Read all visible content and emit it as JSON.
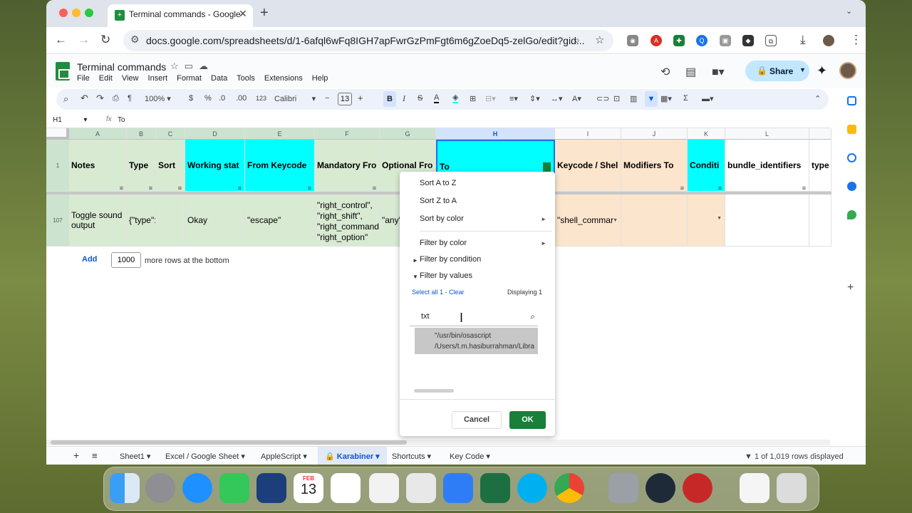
{
  "browser": {
    "tab_title": "Terminal commands - Google",
    "tab_favicon": "+",
    "new_tab": "+",
    "url": "docs.google.com/spreadsheets/d/1-6afql6wFq8IGH7apFwrGzPmFgt6m6gZoeDq5-zelGo/edit?gid..."
  },
  "doc": {
    "title": "Terminal commands",
    "menus": [
      "File",
      "Edit",
      "View",
      "Insert",
      "Format",
      "Data",
      "Tools",
      "Extensions",
      "Help"
    ],
    "share_label": "Share"
  },
  "toolbar": {
    "zoom": "100%",
    "currency": "$",
    "percent": "%",
    "dec_decrease": ".0",
    "dec_increase": ".00",
    "number_format": "123",
    "font": "Calibri",
    "font_size": "13",
    "bold": "B",
    "italic": "I",
    "strike": "S",
    "text_color": "A",
    "function": "Σ"
  },
  "formula_bar": {
    "name_box": "H1",
    "fx": "fx",
    "value": "To"
  },
  "columns": [
    {
      "letter": "A",
      "header": "Notes",
      "r107": "Toggle sound output"
    },
    {
      "letter": "B",
      "header": "Type",
      "r107": "{\"type\":"
    },
    {
      "letter": "C",
      "header": "Sort",
      "r107": ""
    },
    {
      "letter": "D",
      "header": "Working stat",
      "r107": "Okay"
    },
    {
      "letter": "E",
      "header": "From Keycode",
      "r107": "\"escape\""
    },
    {
      "letter": "F",
      "header": "Mandatory Fro",
      "r107_lines": [
        "\"right_control\",",
        "\"right_shift\",",
        "\"right_command\"",
        "\"right_option\""
      ]
    },
    {
      "letter": "G",
      "header": "Optional Fro",
      "r107": "\"any\""
    },
    {
      "letter": "H",
      "header": "To",
      "r107": ""
    },
    {
      "letter": "I",
      "header": "Keycode / Shel",
      "r107": "\"shell_commar"
    },
    {
      "letter": "J",
      "header": "Modifiers To",
      "r107": ""
    },
    {
      "letter": "K",
      "header": "Conditi",
      "r107": ""
    },
    {
      "letter": "L",
      "header": "bundle_identifiers",
      "r107": ""
    },
    {
      "letter": "",
      "header": "type",
      "r107": ""
    }
  ],
  "rows": [
    "1",
    "107"
  ],
  "add_rows": {
    "button": "Add",
    "count": "1000",
    "suffix": "more rows at the bottom"
  },
  "filter_menu": {
    "sort_az": "Sort A to Z",
    "sort_za": "Sort Z to A",
    "sort_color": "Sort by color",
    "filter_color": "Filter by color",
    "filter_condition": "Filter by condition",
    "filter_values": "Filter by values",
    "select_all": "Select all 1",
    "clear": "Clear",
    "displaying": "Displaying 1",
    "search_value": "txt",
    "result_line1": "\"/usr/bin/osascript",
    "result_line2": "/Users/t.m.hasiburrahman/Libra",
    "cancel": "Cancel",
    "ok": "OK"
  },
  "sheet_tabs": [
    "Sheet1",
    "Excel / Google Sheet",
    "AppleScript",
    "Karabiner",
    "Shortcuts",
    "Key Code"
  ],
  "active_tab": "Karabiner",
  "rows_displayed": "1 of 1,019 rows displayed",
  "dock": {
    "calendar_month": "FEB",
    "calendar_day": "13"
  },
  "colors": {
    "header_green": "#d9ead3",
    "header_cyan": "#00ffff",
    "header_orange": "#fce5cd",
    "sheets_green": "#188038"
  }
}
